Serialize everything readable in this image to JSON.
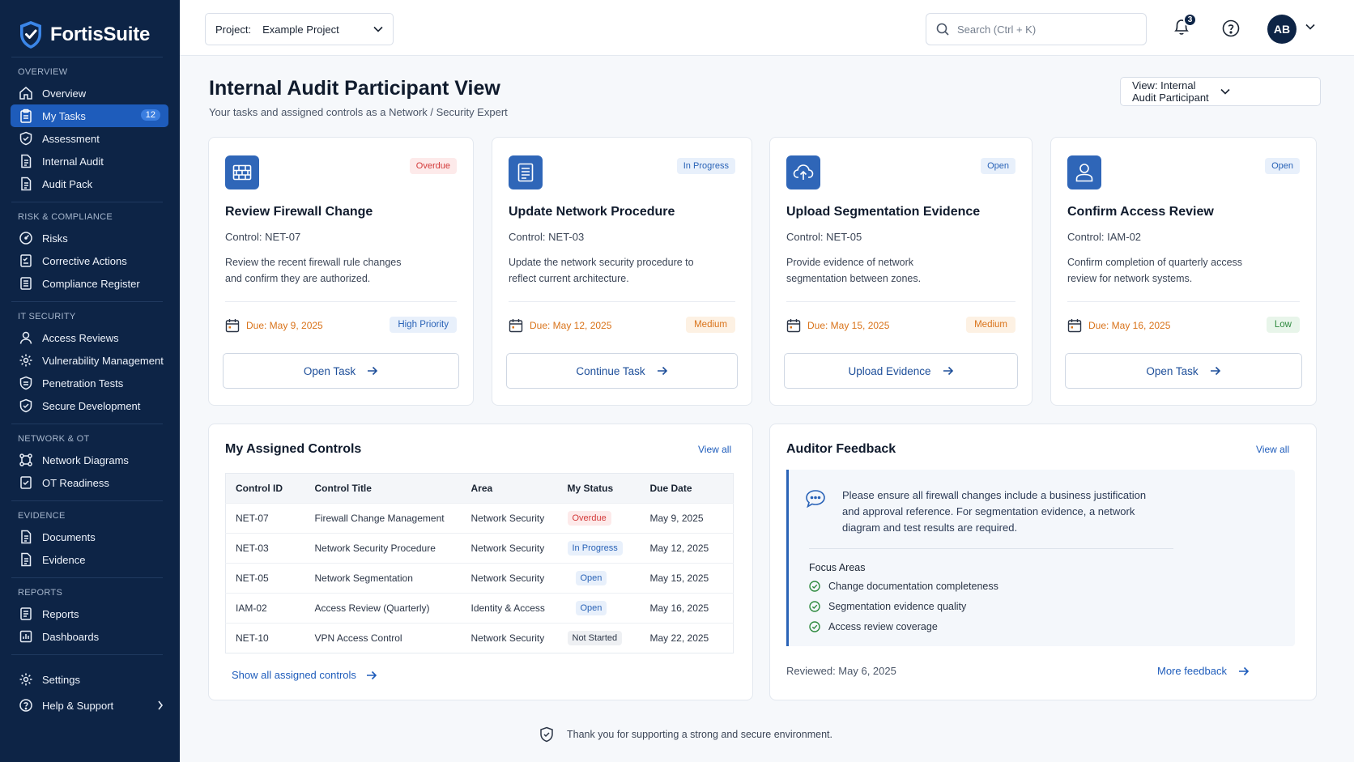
{
  "app": {
    "name": "FortisSuite"
  },
  "sidebar": {
    "sections": {
      "overview": "OVERVIEW",
      "risk": "RISK & COMPLIANCE",
      "it": "IT SECURITY",
      "network": "NETWORK & OT",
      "evidence": "EVIDENCE",
      "reports": "REPORTS"
    },
    "items": {
      "overview": "Overview",
      "my_tasks": "My Tasks",
      "my_tasks_count": "12",
      "assessment": "Assessment",
      "internal_audit": "Internal Audit",
      "audit_pack": "Audit Pack",
      "risks": "Risks",
      "corrective_actions": "Corrective Actions",
      "compliance_register": "Compliance Register",
      "access_reviews": "Access Reviews",
      "vuln_mgmt": "Vulnerability Management",
      "pen_tests": "Penetration Tests",
      "secure_dev": "Secure Development",
      "network_diagrams": "Network Diagrams",
      "ot_readiness": "OT Readiness",
      "documents": "Documents",
      "evidence": "Evidence",
      "reports": "Reports",
      "dashboards": "Dashboards",
      "settings": "Settings",
      "help": "Help & Support"
    }
  },
  "header": {
    "project_label": "Project:",
    "project_value": "Example Project",
    "search_placeholder": "Search (Ctrl + K)",
    "notifications_count": "3",
    "avatar_initials": "AB"
  },
  "page": {
    "title": "Internal Audit Participant View",
    "subtitle": "Your tasks and assigned controls as a Network / Security Expert",
    "view_selector": "View: Internal Audit Participant"
  },
  "tasks": [
    {
      "status": "Overdue",
      "title": "Review Firewall Change",
      "control": "Control: NET-07",
      "desc": "Review the recent firewall rule changes and confirm they are authorized.",
      "due": "Due: May 9, 2025",
      "priority": "High Priority",
      "action": "Open Task"
    },
    {
      "status": "In Progress",
      "title": "Update Network Procedure",
      "control": "Control: NET-03",
      "desc": "Update the network security procedure to reflect current architecture.",
      "due": "Due: May 12, 2025",
      "priority": "Medium",
      "action": "Continue Task"
    },
    {
      "status": "Open",
      "title": "Upload Segmentation Evidence",
      "control": "Control: NET-05",
      "desc": "Provide evidence of network segmentation between zones.",
      "due": "Due: May 15, 2025",
      "priority": "Medium",
      "action": "Upload Evidence"
    },
    {
      "status": "Open",
      "title": "Confirm Access Review",
      "control": "Control: IAM-02",
      "desc": "Confirm completion of quarterly access review for network systems.",
      "due": "Due: May 16, 2025",
      "priority": "Low",
      "action": "Open Task"
    }
  ],
  "controls": {
    "title": "My Assigned Controls",
    "view_all": "View all",
    "columns": [
      "Control ID",
      "Control Title",
      "Area",
      "My Status",
      "Due Date"
    ],
    "rows": [
      [
        "NET-07",
        "Firewall Change Management",
        "Network Security",
        "Overdue",
        "May 9, 2025"
      ],
      [
        "NET-03",
        "Network Security Procedure",
        "Network Security",
        "In Progress",
        "May 12, 2025"
      ],
      [
        "NET-05",
        "Network Segmentation",
        "Network Security",
        "Open",
        "May 15, 2025"
      ],
      [
        "IAM-02",
        "Access Review (Quarterly)",
        "Identity & Access",
        "Open",
        "May 16, 2025"
      ],
      [
        "NET-10",
        "VPN Access Control",
        "Network Security",
        "Not Started",
        "May 22, 2025"
      ]
    ],
    "show_all": "Show all assigned controls"
  },
  "feedback": {
    "title": "Auditor Feedback",
    "view_all": "View all",
    "quote": "Please ensure all firewall changes include a business justification and approval reference. For segmentation evidence, a network diagram and test results are required.",
    "focus_title": "Focus Areas",
    "focus": [
      "Change documentation completeness",
      "Segmentation evidence quality",
      "Access review coverage"
    ],
    "reviewed": "Reviewed: May 6, 2025",
    "more": "More feedback"
  },
  "footer": {
    "text": "Thank you for supporting a strong and secure environment."
  },
  "colors": {
    "sidebar": "#0d2446",
    "accent": "#1e5cbb",
    "danger": "#d33a3a",
    "warning": "#d9731a",
    "success": "#2f8a3f"
  }
}
